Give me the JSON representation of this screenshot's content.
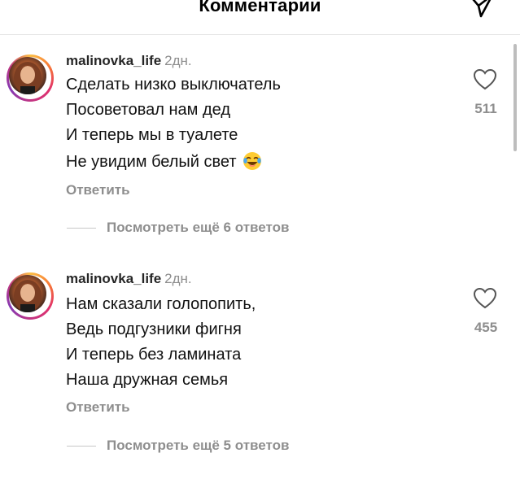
{
  "header": {
    "title": "Комментарии",
    "share_icon": "paper-plane-icon"
  },
  "comments": [
    {
      "username": "malinovka_life",
      "time": "2дн.",
      "lines": [
        "Сделать низко выключатель",
        "Посоветовал нам дед",
        "И теперь мы в туалете",
        "Не увидим белый свет"
      ],
      "emoji": "face-with-tears-of-joy",
      "reply_label": "Ответить",
      "likes": "511",
      "view_replies": "Посмотреть ещё 6 ответов"
    },
    {
      "username": "malinovka_life",
      "time": "2дн.",
      "lines": [
        "Нам сказали голопопить,",
        "Ведь подгузники фигня",
        "И теперь без ламината",
        "Наша дружная семья"
      ],
      "reply_label": "Ответить",
      "likes": "455",
      "view_replies": "Посмотреть ещё 5 ответов"
    }
  ],
  "colors": {
    "secondary_text": "#8e8e8e",
    "primary_text": "#111111",
    "divider": "#e6e6e6",
    "story_ring_start": "#fcbf45",
    "story_ring_end": "#833ab4"
  }
}
